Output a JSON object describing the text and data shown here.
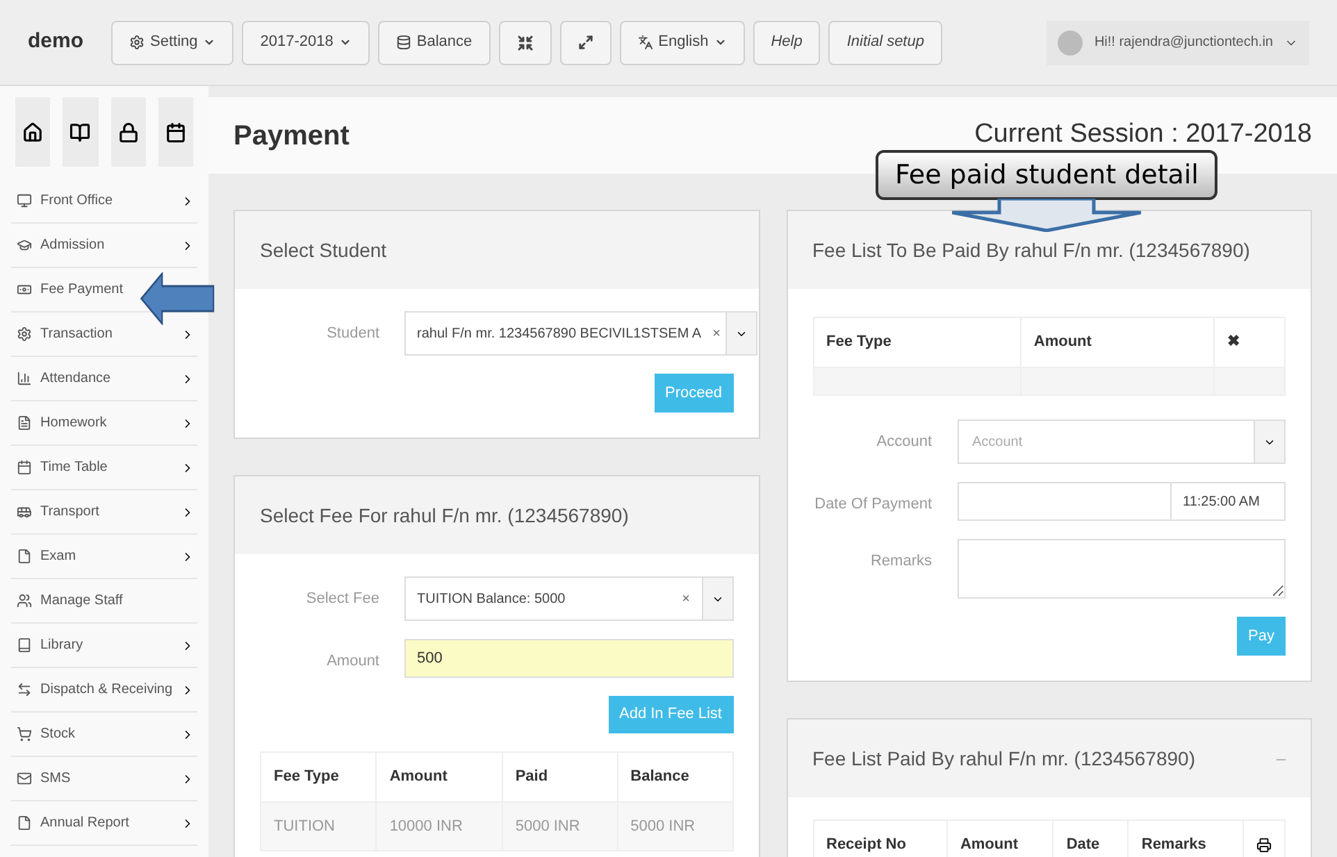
{
  "header": {
    "brand": "demo",
    "buttons": [
      {
        "kind": "gear-menu",
        "label": "Setting"
      },
      {
        "kind": "menu",
        "label": "2017-2018"
      },
      {
        "kind": "database",
        "label": "Balance"
      },
      {
        "kind": "compress"
      },
      {
        "kind": "expand"
      },
      {
        "kind": "language-menu",
        "label": "English"
      },
      {
        "kind": "italic",
        "label": "Help"
      },
      {
        "kind": "italic",
        "label": "Initial setup"
      }
    ],
    "user": "Hi!! rajendra@junctiontech.in"
  },
  "sidebar": {
    "items": [
      {
        "label": "Front Office",
        "chevron": true
      },
      {
        "label": "Admission",
        "chevron": true
      },
      {
        "label": "Fee Payment",
        "chevron": false
      },
      {
        "label": "Transaction",
        "chevron": true
      },
      {
        "label": "Attendance",
        "chevron": true
      },
      {
        "label": "Homework",
        "chevron": true
      },
      {
        "label": "Time Table",
        "chevron": true
      },
      {
        "label": "Transport",
        "chevron": true
      },
      {
        "label": "Exam",
        "chevron": true
      },
      {
        "label": "Manage Staff",
        "chevron": false
      },
      {
        "label": "Library",
        "chevron": true
      },
      {
        "label": "Dispatch & Receiving",
        "chevron": true
      },
      {
        "label": "Stock",
        "chevron": true
      },
      {
        "label": "SMS",
        "chevron": true
      },
      {
        "label": "Annual Report",
        "chevron": true
      }
    ]
  },
  "page": {
    "title": "Payment",
    "session": "Current Session : 2017-2018"
  },
  "select_student": {
    "title": "Select Student",
    "label": "Student",
    "value": "rahul F/n mr. 1234567890 BECIVIL1STSEM A",
    "clear": "×",
    "button": "Proceed"
  },
  "select_fee": {
    "title": "Select Fee For rahul F/n mr. (1234567890)",
    "fee_label": "Select Fee",
    "fee_value": "TUITION Balance: 5000",
    "clear": "×",
    "amount_label": "Amount",
    "amount_value": "500",
    "button": "Add In Fee List",
    "table": {
      "columns": [
        "Fee Type",
        "Amount",
        "Paid",
        "Balance"
      ],
      "rows": [
        [
          "TUITION",
          "10000 INR",
          "5000 INR",
          "5000 INR"
        ]
      ]
    }
  },
  "fee_list": {
    "title": "Fee List To Be Paid By rahul F/n mr. (1234567890)",
    "columns": [
      "Fee Type",
      "Amount",
      "✖"
    ],
    "account_label": "Account",
    "account_placeholder": "Account",
    "date_label": "Date Of Payment",
    "time_value": "11:25:00 AM",
    "remarks_label": "Remarks",
    "button": "Pay"
  },
  "paid_list": {
    "title": "Fee List Paid By rahul F/n mr. (1234567890)",
    "collapse": "–",
    "columns": [
      "Receipt No",
      "Amount",
      "Date",
      "Remarks"
    ]
  },
  "annotations": [
    {
      "kind": "callout",
      "text": "Fee paid student detail"
    },
    {
      "kind": "left-arrow"
    }
  ]
}
